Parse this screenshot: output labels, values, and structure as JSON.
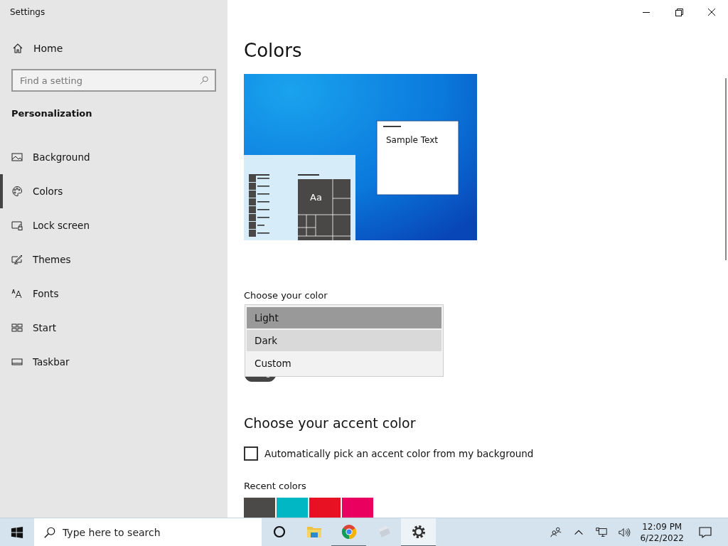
{
  "window": {
    "title": "Settings"
  },
  "sidebar": {
    "home": "Home",
    "search": {
      "placeholder": "Find a setting"
    },
    "section": "Personalization",
    "items": [
      {
        "label": "Background",
        "kind": "background",
        "selected": false
      },
      {
        "label": "Colors",
        "kind": "colors",
        "selected": true
      },
      {
        "label": "Lock screen",
        "kind": "lock",
        "selected": false
      },
      {
        "label": "Themes",
        "kind": "themes",
        "selected": false
      },
      {
        "label": "Fonts",
        "kind": "fonts",
        "selected": false
      },
      {
        "label": "Start",
        "kind": "start",
        "selected": false
      },
      {
        "label": "Taskbar",
        "kind": "taskbar",
        "selected": false
      }
    ]
  },
  "page": {
    "title": "Colors",
    "preview": {
      "sample_text": "Sample Text",
      "tile_label": "Aa"
    },
    "choose_color": {
      "label": "Choose your color",
      "options": [
        {
          "label": "Light",
          "selected": true,
          "hovered": false
        },
        {
          "label": "Dark",
          "selected": false,
          "hovered": true
        },
        {
          "label": "Custom",
          "selected": false,
          "hovered": false
        }
      ]
    },
    "toggle": {
      "on": true
    },
    "accent": {
      "title": "Choose your accent color",
      "auto_pick": {
        "label": "Automatically pick an accent color from my background",
        "checked": false
      },
      "recent_label": "Recent colors",
      "recent_colors": [
        {
          "color": "#4c4a48"
        },
        {
          "color": "#00b7c3"
        },
        {
          "color": "#e81123"
        },
        {
          "color": "#ea005e"
        }
      ]
    }
  },
  "taskbar": {
    "search": {
      "placeholder": "Type here to search"
    },
    "apps": [
      {
        "kind": "cortana",
        "running": false,
        "active": false
      },
      {
        "kind": "explorer",
        "running": false,
        "active": false
      },
      {
        "kind": "chrome",
        "running": true,
        "active": false
      },
      {
        "kind": "app",
        "running": false,
        "active": false
      },
      {
        "kind": "settings",
        "running": true,
        "active": true
      }
    ],
    "time": "12:09 PM",
    "date": "6/22/2022"
  }
}
